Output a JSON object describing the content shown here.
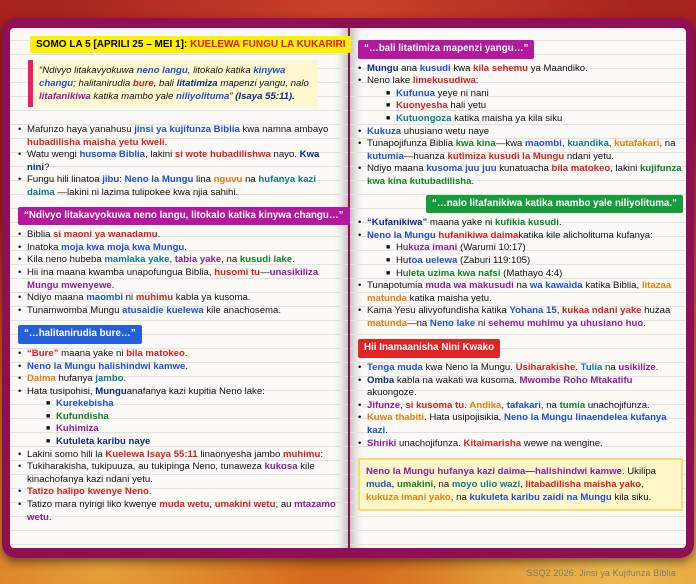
{
  "header": {
    "lesson": "SOMO LA 5 [APRILI 25 – MEI 1]:",
    "title": "KUELEWA FUNGU LA KUKARIRI"
  },
  "quote": {
    "p1": "“Ndivyo litakavyokuwa ",
    "p2": "neno langu",
    ",": ", litokalo katika ",
    "p4": "kinywa changu",
    "p5": "; halitanirudia ",
    "p6": "bure",
    ",6": ", bali ",
    "p8": "litatimiza",
    "p9": " mapenzi yangu, nalo ",
    "p10": "litafanikiwa",
    "p11": " katika mambo yale ",
    "p12": "niliyolituma",
    "p13": "” ",
    "ref": "(Isaya 55:11)."
  },
  "intro": [
    [
      "Mafunzo haya yanahusu ",
      "jinsi ya kujifunza Biblia",
      " kwa namna ambayo ",
      "hubadilisha maisha yetu kweli",
      "."
    ],
    [
      "Watu wengi ",
      "husoma Biblia",
      ", lakini ",
      "si wote hubadilishwa",
      " nayo. ",
      "Kwa nini",
      "?"
    ],
    [
      "Fungu hili linatoa ",
      "jibu",
      ": ",
      "Neno la Mungu",
      " lina ",
      "nguvu",
      " na ",
      "hufanya kazi daima",
      " —lakini ni lazima ",
      "tulipokee kwa njia sahihi",
      "."
    ]
  ],
  "sec1": {
    "label": "“Ndivyo litakavyokuwa neno langu, litokalo katika kinywa changu…”",
    "items": [
      [
        "Biblia ",
        "si maoni ya wanadamu",
        "."
      ],
      [
        "Inatoka ",
        "moja kwa moja kwa Mungu",
        "."
      ],
      [
        "Kila neno hubeba ",
        "mamlaka yake",
        ", ",
        "tabia yake",
        ", na ",
        "kusudi lake",
        "."
      ],
      [
        "Hii ina maana kwamba unapofungua Biblia, ",
        "husomi tu",
        "—",
        "unasikiliza Mungu mwenyewe",
        "."
      ],
      [
        "Ndiyo maana ",
        "maombi",
        " ni ",
        "muhimu",
        " kabla ya kusoma."
      ],
      [
        "Tunamwomba Mungu ",
        "atusaidie kuelewa",
        " kile anachosema."
      ]
    ]
  },
  "sec2": {
    "label": "“…halitanirudia bure…”",
    "items": [
      [
        "“Bure”",
        " maana yake ni ",
        "bila matokeo",
        "."
      ],
      [
        "Neno la Mungu ",
        "halishindwi kamwe",
        "."
      ],
      [
        "Daima",
        " hufanya ",
        "jambo",
        "."
      ],
      [
        "Hata tusipohisi, ",
        "Mungu",
        "anafanya kazi kupitia Neno lake:"
      ]
    ],
    "sub": [
      "Kurekebisha",
      "Kufundisha",
      "Kuhimiza",
      "Kutuleta karibu naye"
    ],
    "items2": [
      [
        "Lakini somo hili la ",
        "Kuelewa Isaya 55:11",
        " linaonyesha jambo ",
        "muhimu",
        ":"
      ],
      [
        "Tukiharakisha, tukipuuza, au tukipinga Neno, tunaweza ",
        "kukosa",
        " kile kinachofanya kazi ndani yetu."
      ],
      [
        "Tatizo halipo kwenye Neno",
        "."
      ],
      [
        "Tatizo mara nyingi liko kwenye ",
        "muda wetu",
        ", ",
        "umakini wetu",
        ", au ",
        "mtazamo wetu",
        "."
      ]
    ]
  },
  "sec3": {
    "label": "“…bali litatimiza mapenzi yangu…”",
    "items": [
      [
        "Mungu",
        " ana ",
        "kusudi",
        " kwa ",
        "kila sehemu",
        " ya Maandiko."
      ],
      [
        "Neno lake ",
        "limekusudiwa",
        ":"
      ]
    ],
    "sub": [
      [
        "Kufunua",
        " yeye ni nani"
      ],
      [
        "Kuonyesha",
        " hali yetu"
      ],
      [
        "Kutuongoza",
        " katika maisha ya kila siku"
      ]
    ],
    "items2": [
      [
        "Kukuza",
        " uhusiano wetu naye"
      ],
      [
        "Tunapojifunza Biblia ",
        "kwa kina",
        "—kwa ",
        "maombi",
        ", ",
        "kuandika",
        ", ",
        "kutafakari",
        ", na ",
        "kutumia",
        "—huanza ",
        "kutimiza kusudi la Mungu",
        " ndani yetu."
      ],
      [
        "Ndiyo maana ",
        "kusoma juu juu",
        " kunatuacha ",
        "bila matokeo",
        ", lakini ",
        "kujifunza kwa kina kutubadilisha",
        "."
      ]
    ]
  },
  "sec4": {
    "label": "“…nalo litafanikiwa katika mambo yale niliyolituma.”",
    "items": [
      [
        "“Kufanikiwa”",
        " maana yake ni ",
        "kufikia kusudi",
        "."
      ],
      [
        "Neno la Mungu ",
        "hufanikiwa daima",
        "katika kile alicholituma kufanya:"
      ]
    ],
    "sub": [
      [
        "Hu",
        "kuza imani",
        " (Warumi 10:17)"
      ],
      [
        "Hu",
        "toa uelewa",
        " (Zaburi 119:105)"
      ],
      [
        "Hu",
        "leta uzima kwa nafsi",
        " (Mathayo 4:4)"
      ]
    ],
    "items2": [
      [
        "Tunapotumia ",
        "muda wa makusudi",
        " na ",
        "wa kawaida",
        " katika Biblia, ",
        "litazaa matunda",
        " katika maisha yetu."
      ],
      [
        "Kama Yesu alivyofundisha katika ",
        "Yohana 15",
        ", ",
        "kukaa ndani yake",
        " huzaa ",
        "matunda",
        "—na ",
        "Neno lake",
        " ni ",
        "sehemu muhimu ya uhusiano huo",
        "."
      ]
    ]
  },
  "sec5": {
    "label": "Hii Inamaanisha Nini Kwako",
    "items": [
      [
        "Tenga muda",
        " kwa Neno la Mungu. ",
        "Usiharakishe",
        ". ",
        "Tulia",
        " na ",
        "usikilize",
        "."
      ],
      [
        "Omba",
        " kabla na wakati wa kusoma. ",
        "Mwombe Roho Mtakatifu",
        " akuongoze."
      ],
      [
        "Jifunze",
        ", ",
        "si kusoma tu",
        ". ",
        "Andika",
        ", ",
        "tafakari",
        ", na ",
        "tumia",
        " unachojifunza."
      ],
      [
        "Kuwa thabiti",
        ". Hata usipojisikia, ",
        "Neno la Mungu linaendelea kufanya kazi",
        "."
      ],
      [
        "Shiriki",
        " unachojifunza. ",
        "Kitaimarisha",
        " wewe na wengine."
      ]
    ]
  },
  "note": [
    "Neno la Mungu hufanya kazi daima—halishindwi kamwe",
    ". Ukilipa ",
    "muda",
    ", ",
    "umakini",
    ", na ",
    "moyo ulio wazi",
    ", ",
    "litabadilisha maisha yako",
    ", ",
    "kukuza imani yako",
    ", na ",
    "kukuleta karibu zaidi na Mungu",
    " kila siku."
  ],
  "footer": "SSQ2 2026: Jinsi ya Kujifunza Biblia",
  "colors": {
    "cover": "#8e0f55",
    "highlight": "#fff200",
    "label_purple": "#b5179e",
    "label_blue": "#2460d8",
    "label_green": "#169c3a",
    "label_red": "#e02525"
  }
}
